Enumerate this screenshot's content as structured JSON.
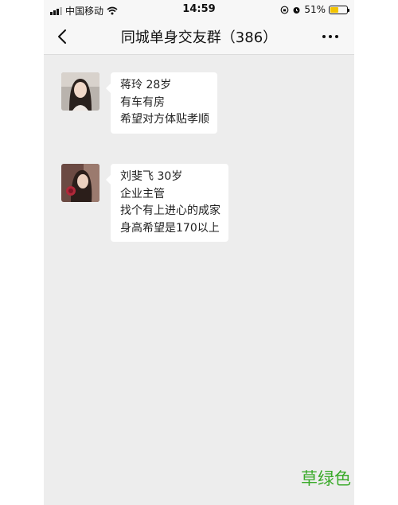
{
  "status_bar": {
    "carrier": "中国移动",
    "time": "14:59",
    "battery_percent": "51%",
    "battery_level": 0.51
  },
  "nav": {
    "title": "同城单身交友群（386）",
    "back_icon": "chevron-left-icon",
    "more_icon": "more-horizontal-icon"
  },
  "messages": [
    {
      "lines": [
        "蒋玲  28岁",
        "有车有房",
        "希望对方体贴孝顺"
      ]
    },
    {
      "lines": [
        "刘斐飞   30岁",
        "企业主管",
        "找个有上进心的成家",
        "身高希望是170以上"
      ]
    }
  ],
  "watermark": "草绿色",
  "colors": {
    "accent_watermark": "#3aaa2a",
    "battery": "#f2c300",
    "chat_bg": "#ededed"
  }
}
